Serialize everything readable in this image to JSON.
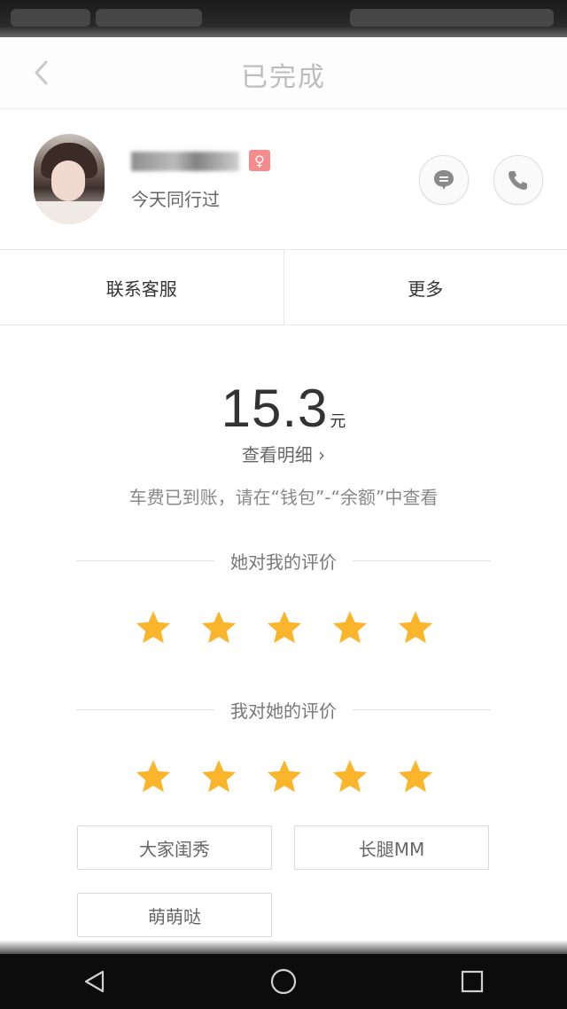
{
  "header": {
    "title": "已完成"
  },
  "profile": {
    "gender_symbol": "♀",
    "subtitle": "今天同行过"
  },
  "actions": {
    "contact_service": "联系客服",
    "more": "更多"
  },
  "fare": {
    "amount": "15.3",
    "unit": "元",
    "detail_link": "查看明细 ›",
    "notice": "车费已到账，请在“钱包”-“余额”中查看"
  },
  "ratings": {
    "her_rating_title": "她对我的评价",
    "her_rating_stars": 5,
    "my_rating_title": "我对她的评价",
    "my_rating_stars": 5
  },
  "tags": [
    "大家闺秀",
    "长腿MM",
    "萌萌哒"
  ],
  "colors": {
    "star": "#FBB52C",
    "gender_badge": "#F58B8B",
    "title_text": "#BDBDBD"
  },
  "icons": {
    "back": "back-arrow-icon",
    "message": "message-bubble-icon",
    "phone": "phone-icon",
    "nav_back": "triangle-back-icon",
    "nav_home": "circle-home-icon",
    "nav_recent": "square-recent-icon"
  }
}
